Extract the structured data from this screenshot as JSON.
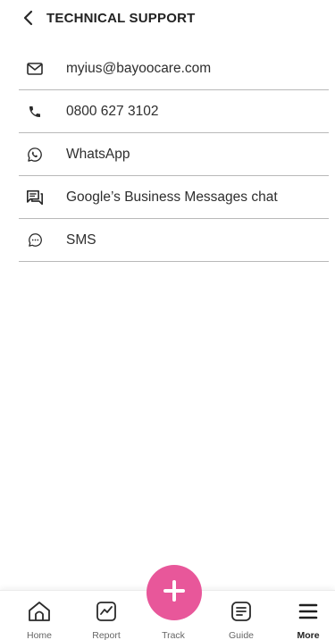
{
  "header": {
    "title": "TECHNICAL SUPPORT",
    "back_icon": "chevron-left-icon"
  },
  "contacts": [
    {
      "label": "myius@bayoocare.com",
      "icon": "mail-icon"
    },
    {
      "label": "0800 627 3102",
      "icon": "phone-icon"
    },
    {
      "label": "WhatsApp",
      "icon": "whatsapp-icon"
    },
    {
      "label": "Google’s Business Messages chat",
      "icon": "chat-icon"
    },
    {
      "label": "SMS",
      "icon": "sms-icon"
    }
  ],
  "bottom_nav": {
    "items": [
      {
        "label": "Home",
        "icon": "home-icon"
      },
      {
        "label": "Report",
        "icon": "chart-icon"
      },
      {
        "label": "Track",
        "icon": "plus-icon"
      },
      {
        "label": "Guide",
        "icon": "guide-icon"
      },
      {
        "label": "More",
        "icon": "menu-icon",
        "active": true
      }
    ]
  },
  "colors": {
    "accent": "#e8579a",
    "divider": "#b9b9b9",
    "text": "#2e2e2e"
  }
}
